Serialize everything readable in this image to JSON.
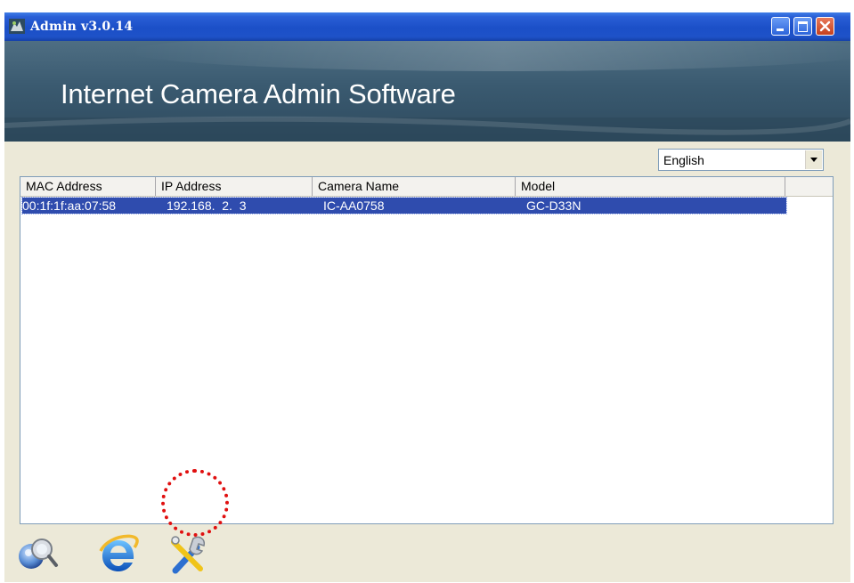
{
  "window": {
    "title": "Admin v3.0.14"
  },
  "banner": {
    "title": "Internet Camera Admin Software"
  },
  "language": {
    "selected": "English"
  },
  "table": {
    "columns": [
      "MAC Address",
      "IP Address",
      "Camera Name",
      "Model"
    ],
    "rows": [
      {
        "mac": "00:1f:1f:aa:07:58",
        "ip": "192.168.  2.  3",
        "name": "IC-AA0758",
        "model": "GC-D33N",
        "selected": true
      }
    ]
  },
  "toolbar": {
    "icons": [
      "search-camera-icon",
      "internet-explorer-icon",
      "settings-tools-icon"
    ]
  },
  "colors": {
    "titlebar": "#1b4fc7",
    "selection": "#2f4cae",
    "highlight_ring": "#e01010"
  }
}
